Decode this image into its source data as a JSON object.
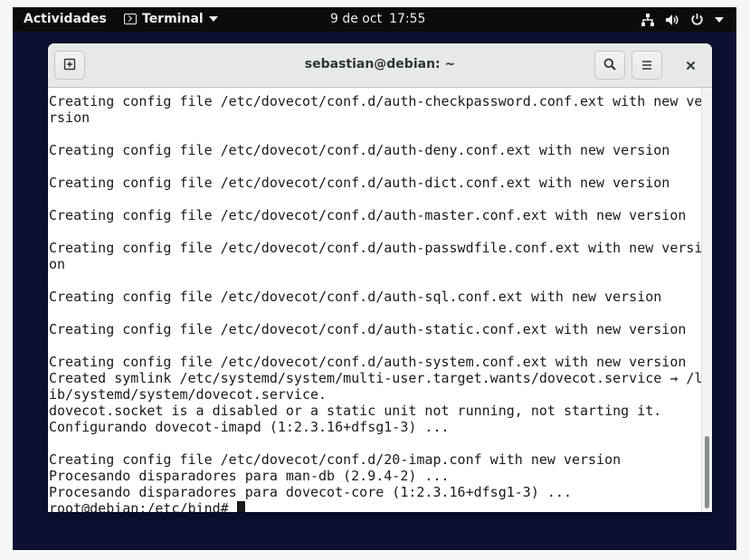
{
  "topbar": {
    "activities_label": "Actividades",
    "app_menu_label": "Terminal",
    "clock_date": "9 de oct",
    "clock_time": "17:55",
    "tray_icons": [
      "network-icon",
      "volume-icon",
      "power-icon",
      "chevron-down-icon"
    ]
  },
  "window": {
    "title": "sebastian@debian: ~",
    "new_tab_icon": "new-tab-icon",
    "search_icon": "search-icon",
    "menu_icon": "hamburger-menu-icon",
    "close_icon": "close-icon"
  },
  "terminal": {
    "lines": [
      "Creating config file /etc/dovecot/conf.d/auth-checkpassword.conf.ext with new ve",
      "rsion",
      "",
      "Creating config file /etc/dovecot/conf.d/auth-deny.conf.ext with new version",
      "",
      "Creating config file /etc/dovecot/conf.d/auth-dict.conf.ext with new version",
      "",
      "Creating config file /etc/dovecot/conf.d/auth-master.conf.ext with new version",
      "",
      "Creating config file /etc/dovecot/conf.d/auth-passwdfile.conf.ext with new versi",
      "on",
      "",
      "Creating config file /etc/dovecot/conf.d/auth-sql.conf.ext with new version",
      "",
      "Creating config file /etc/dovecot/conf.d/auth-static.conf.ext with new version",
      "",
      "Creating config file /etc/dovecot/conf.d/auth-system.conf.ext with new version",
      "Created symlink /etc/systemd/system/multi-user.target.wants/dovecot.service → /l",
      "ib/systemd/system/dovecot.service.",
      "dovecot.socket is a disabled or a static unit not running, not starting it.",
      "Configurando dovecot-imapd (1:2.3.16+dfsg1-3) ...",
      "",
      "Creating config file /etc/dovecot/conf.d/20-imap.conf with new version",
      "Procesando disparadores para man-db (2.9.4-2) ...",
      "Procesando disparadores para dovecot-core (1:2.3.16+dfsg1-3) ..."
    ],
    "prompt": "root@debian:/etc/bind# "
  }
}
